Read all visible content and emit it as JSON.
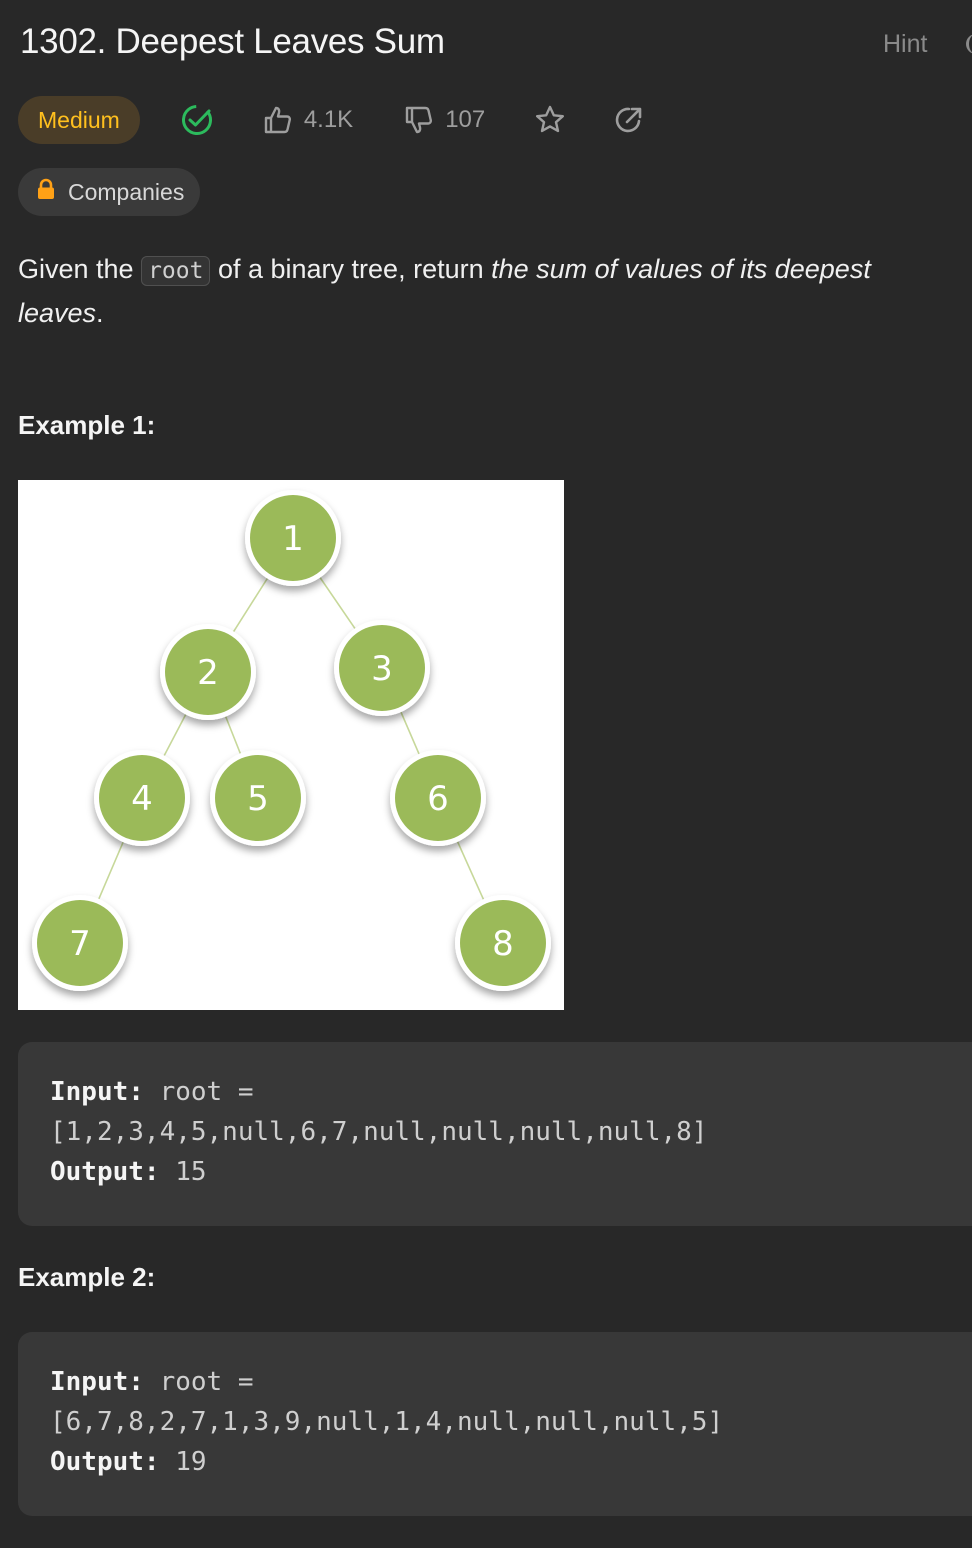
{
  "problem": {
    "title": "1302. Deepest Leaves Sum",
    "hint_label": "Hint",
    "difficulty": "Medium",
    "likes": "4.1K",
    "dislikes": "107",
    "companies_label": "Companies",
    "colors": {
      "difficulty_text": "#ffc01e",
      "difficulty_bg": "#4a3d28",
      "solved_check": "#2cbb5d",
      "background": "#282828"
    }
  },
  "description": {
    "part1": "Given the ",
    "code": "root",
    "part2": " of a binary tree, return ",
    "emphasis": "the sum of values of its deepest leaves",
    "part3": "."
  },
  "examples": [
    {
      "heading": "Example 1:",
      "input_label": "Input:",
      "input_prefix": "root =",
      "input_value": "[1,2,3,4,5,null,6,7,null,null,null,null,8]",
      "output_label": "Output:",
      "output_value": "15"
    },
    {
      "heading": "Example 2:",
      "input_label": "Input:",
      "input_prefix": "root =",
      "input_value": "[6,7,8,2,7,1,3,9,null,1,4,null,null,null,5]",
      "output_label": "Output:",
      "output_value": "19"
    }
  ],
  "tree_figure": {
    "nodes": [
      {
        "id": 1,
        "label": "1"
      },
      {
        "id": 2,
        "label": "2"
      },
      {
        "id": 3,
        "label": "3"
      },
      {
        "id": 4,
        "label": "4"
      },
      {
        "id": 5,
        "label": "5"
      },
      {
        "id": 6,
        "label": "6"
      },
      {
        "id": 7,
        "label": "7"
      },
      {
        "id": 8,
        "label": "8"
      }
    ],
    "edges": [
      [
        1,
        2
      ],
      [
        1,
        3
      ],
      [
        2,
        4
      ],
      [
        2,
        5
      ],
      [
        3,
        6
      ],
      [
        4,
        7
      ],
      [
        6,
        8
      ]
    ],
    "node_color": "#9bba59",
    "edge_color": "#c7d89a"
  }
}
